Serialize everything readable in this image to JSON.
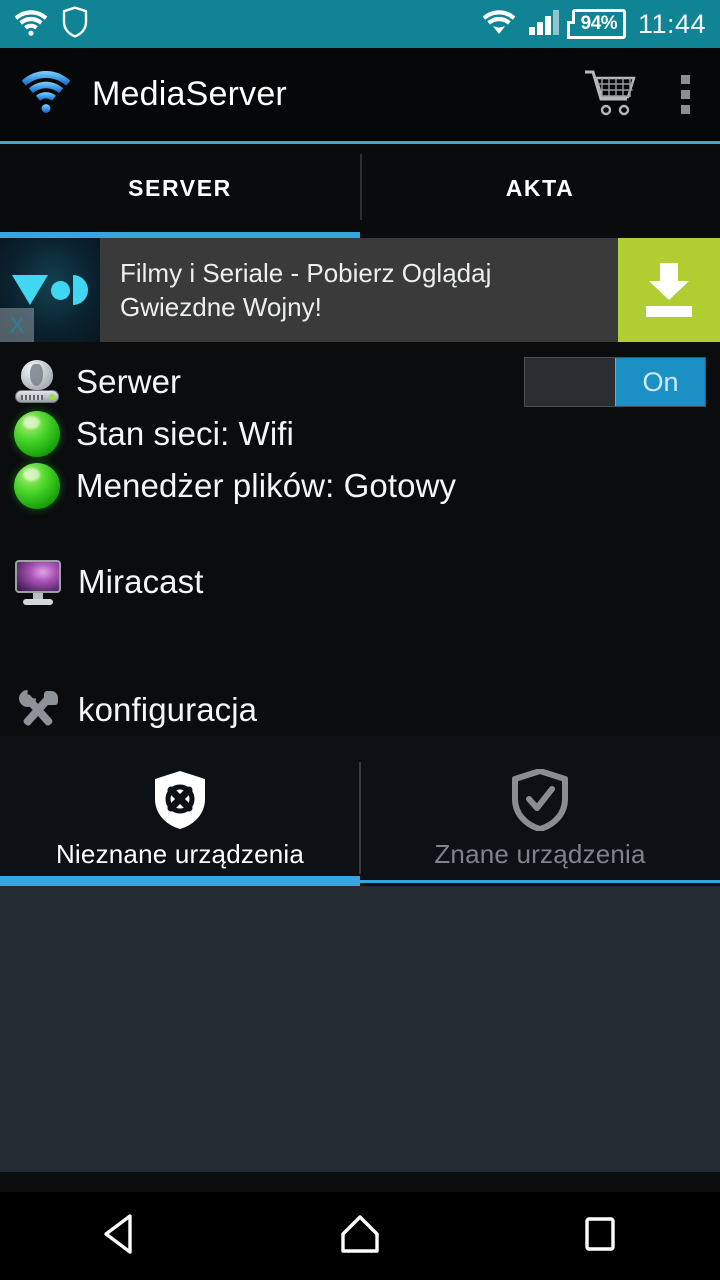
{
  "status_bar": {
    "wifi_icon": "wifi-icon",
    "shield_icon": "shield-outline-icon",
    "wifi_signal_icon": "wifi-signal-icon",
    "cell_signal_icon": "cellular-signal-icon",
    "battery_percent": "94%",
    "time": "11:44",
    "background_color": "#108394"
  },
  "app_bar": {
    "logo_icon": "wifi-logo-icon",
    "title": "MediaServer",
    "cart_icon": "shopping-cart-icon",
    "overflow_icon": "overflow-menu-icon",
    "accent_color": "#3aa8dd"
  },
  "main_tabs": {
    "items": [
      {
        "label": "SERVER",
        "active": true
      },
      {
        "label": "AKTA",
        "active": false
      }
    ],
    "active_color": "#34a8dd"
  },
  "ad_banner": {
    "logo_icon": "vod-logo-icon",
    "close_icon": "ad-close-icon",
    "close_label": "X",
    "line1": "Filmy i Seriale - Pobierz Oglądaj",
    "line2": "Gwiezdne Wojny!",
    "download_icon": "download-icon",
    "button_color": "#b0ce32",
    "logo_color": "#41d7f2"
  },
  "server_panel": {
    "server_row": {
      "icon": "server-icon",
      "label": "Serwer",
      "switch": {
        "state_label": "On",
        "on_color": "#1b90c4"
      }
    },
    "status_rows": [
      {
        "icon": "status-dot-green-icon",
        "label": "Stan sieci: Wifi"
      },
      {
        "icon": "status-dot-green-icon",
        "label": "Menedżer plików: Gotowy"
      }
    ],
    "miracast_row": {
      "icon": "monitor-icon",
      "label": "Miracast"
    },
    "config_row": {
      "icon": "tools-icon",
      "label": "konfiguracja"
    }
  },
  "device_tabs": {
    "items": [
      {
        "label": "Nieznane urządzenia",
        "icon": "shield-x-icon",
        "active": true
      },
      {
        "label": "Znane urządzenia",
        "icon": "shield-check-icon",
        "active": false
      }
    ],
    "active_color": "#34a8dd",
    "inactive_text_color": "#7d848b"
  },
  "nav_bar": {
    "back_icon": "back-triangle-icon",
    "home_icon": "home-icon",
    "recents_icon": "recents-square-icon"
  }
}
